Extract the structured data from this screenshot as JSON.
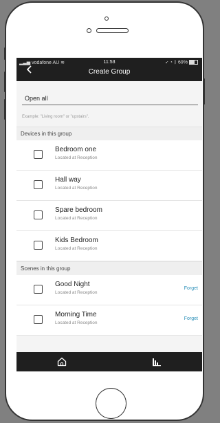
{
  "status_bar": {
    "carrier": "vodafone AU",
    "time": "11:53",
    "battery": "69%"
  },
  "nav": {
    "back_icon": "chevron-left-icon",
    "title": "Create Group"
  },
  "group_name": {
    "value": "Open all",
    "hint": "Example: \"Living room\" or \"upstairs\"."
  },
  "devices_section": {
    "title": "Devices in this group",
    "items": [
      {
        "name": "Bedroom one",
        "location": "Located at Reception"
      },
      {
        "name": "Hall way",
        "location": "Located at Reception"
      },
      {
        "name": "Spare bedroom",
        "location": "Located at Reception"
      },
      {
        "name": "Kids Bedroom",
        "location": "Located at Reception"
      }
    ]
  },
  "scenes_section": {
    "title": "Scenes in this group",
    "items": [
      {
        "name": "Good Night",
        "location": "Located at Reception",
        "action": "Forget"
      },
      {
        "name": "Morning Time",
        "location": "Located at Reception",
        "action": "Forget"
      }
    ]
  },
  "bottom_tabs": {
    "items": [
      {
        "icon": "home-icon"
      },
      {
        "icon": "chart-icon"
      }
    ]
  },
  "colors": {
    "bar_background": "#1f1f1f",
    "link": "#2b8fb8",
    "frame_background": "#808080"
  }
}
